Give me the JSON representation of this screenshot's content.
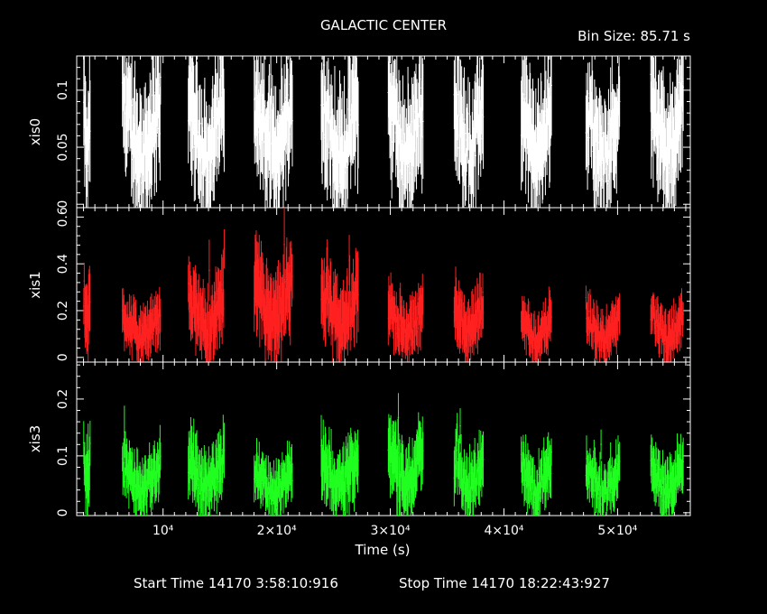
{
  "title": "GALACTIC CENTER",
  "bin_size_label": "Bin Size: 85.71 s",
  "footer": {
    "start": "Start Time 14170  3:58:10:916",
    "stop": "Stop Time 14170 18:22:43:927"
  },
  "colors": {
    "background": "#000000",
    "axes": "#ffffff",
    "xis0": "#ffffff",
    "xis1": "#ff2020",
    "xis3": "#20ff20"
  },
  "chart_data": {
    "type": "scatter",
    "xlabel": "Time (s)",
    "xlim": [
      2400,
      56400
    ],
    "x_ticks": [
      {
        "value": 10000,
        "label": "10⁴"
      },
      {
        "value": 20000,
        "label": "2×10⁴"
      },
      {
        "value": 30000,
        "label": "3×10⁴"
      },
      {
        "value": 40000,
        "label": "4×10⁴"
      },
      {
        "value": 50000,
        "label": "5×10⁴"
      }
    ],
    "segments": [
      [
        3000,
        3600
      ],
      [
        6400,
        9800
      ],
      [
        12200,
        15400
      ],
      [
        18000,
        21400
      ],
      [
        23900,
        27200
      ],
      [
        29800,
        32900
      ],
      [
        35600,
        38200
      ],
      [
        41500,
        44200
      ],
      [
        47200,
        50200
      ],
      [
        52900,
        55800
      ]
    ],
    "panels": [
      {
        "name": "xis0",
        "ylabel": "xis0",
        "ylim": [
          -0.003,
          0.13
        ],
        "y_ticks": [
          {
            "value": 0,
            "label": "0"
          },
          {
            "value": 0.05,
            "label": "0.05"
          },
          {
            "value": 0.1,
            "label": "0.1"
          }
        ],
        "segment_means": [
          0.06,
          0.065,
          0.065,
          0.065,
          0.065,
          0.065,
          0.063,
          0.062,
          0.06,
          0.065
        ],
        "point_count": 640
      },
      {
        "name": "xis1",
        "ylabel": "xis1",
        "ylim": [
          -0.02,
          0.64
        ],
        "y_ticks": [
          {
            "value": 0,
            "label": "0"
          },
          {
            "value": 0.2,
            "label": "0.2"
          },
          {
            "value": 0.4,
            "label": "0.4"
          },
          {
            "value": 0.6,
            "label": "0.6"
          }
        ],
        "segment_means": [
          0.2,
          0.13,
          0.18,
          0.22,
          0.2,
          0.15,
          0.16,
          0.12,
          0.12,
          0.13
        ],
        "point_count": 640
      },
      {
        "name": "xis3",
        "ylabel": "xis3",
        "ylim": [
          -0.005,
          0.265
        ],
        "y_ticks": [
          {
            "value": 0,
            "label": "0"
          },
          {
            "value": 0.1,
            "label": "0.1"
          },
          {
            "value": 0.2,
            "label": "0.2"
          }
        ],
        "segment_means": [
          0.08,
          0.06,
          0.07,
          0.055,
          0.07,
          0.08,
          0.065,
          0.06,
          0.055,
          0.06
        ],
        "point_count": 640
      }
    ]
  }
}
